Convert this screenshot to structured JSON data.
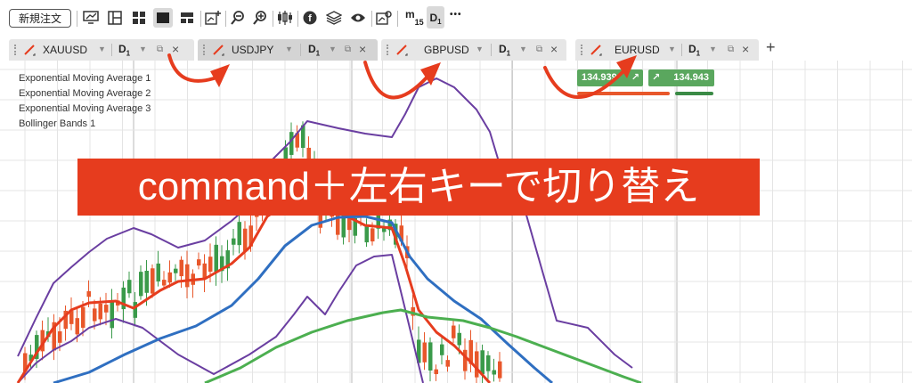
{
  "toolbar": {
    "new_order_label": "新規注文",
    "timeframe_m15": "m",
    "timeframe_m15_sub": "15",
    "timeframe_d1": "D",
    "timeframe_d1_sub": "1",
    "more_label": "•••"
  },
  "tabs": [
    {
      "symbol": "XAUUSD",
      "timeframe": "D",
      "timeframe_sub": "1"
    },
    {
      "symbol": "USDJPY",
      "timeframe": "D",
      "timeframe_sub": "1"
    },
    {
      "symbol": "GBPUSD",
      "timeframe": "D",
      "timeframe_sub": "1"
    },
    {
      "symbol": "EURUSD",
      "timeframe": "D",
      "timeframe_sub": "1"
    }
  ],
  "add_tab_label": "+",
  "legend": [
    "Exponential Moving Average 1",
    "Exponential Moving Average 2",
    "Exponential Moving Average 3",
    "Bollinger Bands 1"
  ],
  "quotes": {
    "sell": "134.939",
    "buy": "134.943",
    "sell_color": "#5aa75e",
    "buy_color": "#5aa75e"
  },
  "banner_text": "command＋左右キーで切り替え",
  "colors": {
    "bull": "#3a9a4a",
    "bear": "#e8572b",
    "ema1": "#e63c1e",
    "ema2": "#2f6fc1",
    "ema3": "#4caf50",
    "bollinger": "#6a3ea1",
    "annotation": "#e63c1e"
  }
}
